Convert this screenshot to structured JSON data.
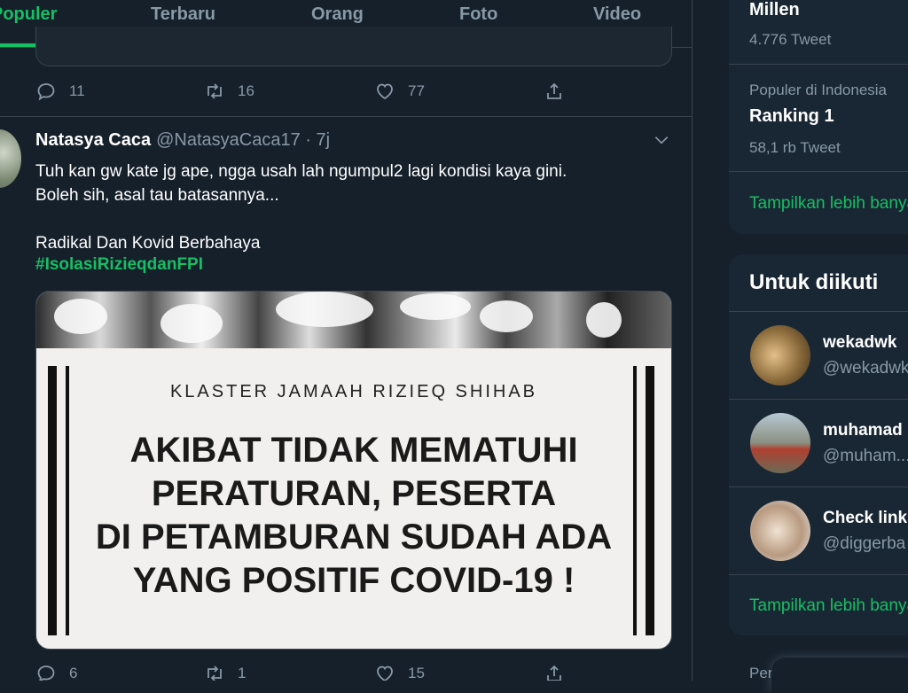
{
  "tabs": {
    "populer": "Populer",
    "terbaru": "Terbaru",
    "orang": "Orang",
    "foto": "Foto",
    "video": "Video"
  },
  "prev_tweet": {
    "replies": "11",
    "retweets": "16",
    "likes": "77"
  },
  "tweet": {
    "name": "Natasya Caca",
    "handle": "@NatasyaCaca17 · 7j",
    "text": "Tuh kan gw kate jg ape, ngga usah lah ngumpul2 lagi kondisi kaya gini.\nBoleh sih, asal tau batasannya...\n\nRadikal Dan Kovid Berbahaya",
    "hashtag": "#IsolasiRizieqdanFPI",
    "media": {
      "subtitle": "KLASTER JAMAAH RIZIEQ SHIHAB",
      "headline": "AKIBAT TIDAK MEMATUHI\nPERATURAN, PESERTA\nDI PETAMBURAN SUDAH ADA\nYANG POSITIF COVID-19 !"
    },
    "replies": "6",
    "retweets": "1",
    "likes": "15"
  },
  "trends": {
    "item1_title": "Millen",
    "item1_count": "4.776 Tweet",
    "item2_context": "Populer di Indonesia",
    "item2_title": "Ranking 1",
    "item2_count": "58,1 rb Tweet",
    "show_more": "Tampilkan lebih banyak"
  },
  "who_to_follow": {
    "title": "Untuk diikuti",
    "users": [
      {
        "name": "wekadwk",
        "handle": "@wekadwk"
      },
      {
        "name": "muhamad",
        "handle": "@muham..."
      },
      {
        "name": "Check link",
        "handle": "@diggerba"
      }
    ],
    "show_more": "Tampilkan lebih banyak"
  },
  "footer_partial": "Per",
  "colors": {
    "accent": "#17bf63",
    "bg": "#15202b",
    "card": "#192734",
    "muted": "#8899a6",
    "border": "#38444d"
  }
}
